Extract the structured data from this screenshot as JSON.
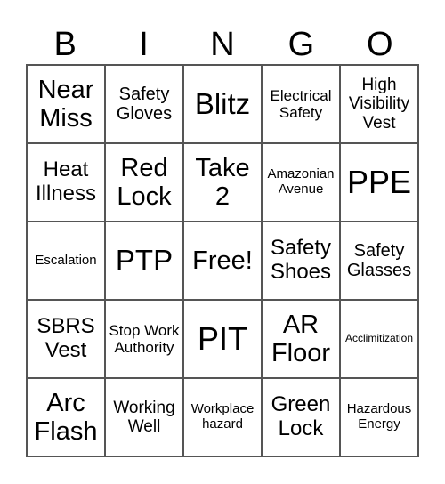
{
  "header": [
    "B",
    "I",
    "N",
    "G",
    "O"
  ],
  "cells": [
    "Near Miss",
    "Safety Gloves",
    "Blitz",
    "Electrical Safety",
    "High Visibility Vest",
    "Heat Illness",
    "Red Lock",
    "Take 2",
    "Amazonian Avenue",
    "PPE",
    "Escalation",
    "PTP",
    "Free!",
    "Safety Shoes",
    "Safety Glasses",
    "SBRS Vest",
    "Stop Work Authority",
    "PIT",
    "AR Floor",
    "Acclimitization",
    "Arc Flash",
    "Working Well",
    "Workplace hazard",
    "Green Lock",
    "Hazardous Energy"
  ]
}
